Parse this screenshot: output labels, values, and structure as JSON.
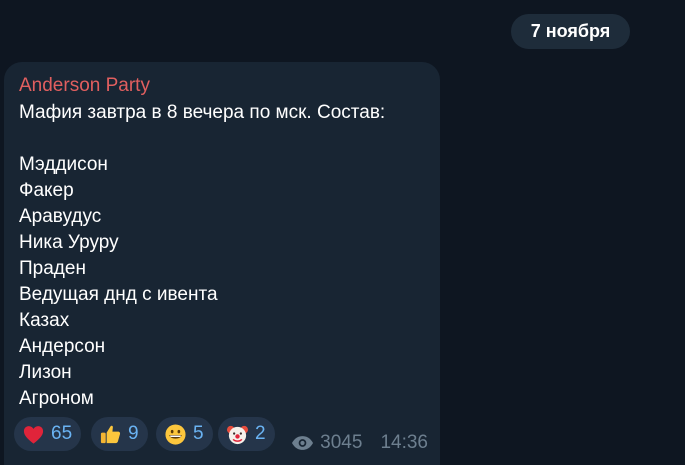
{
  "date_label": "7 ноября",
  "message": {
    "sender": "Anderson Party",
    "lines": [
      "Мафия завтра в 8 вечера по мск. Состав:",
      "",
      "Мэддисон",
      "Факер",
      "Аравудус",
      "Ника Уруру",
      "Праден",
      "Ведущая днд с ивента",
      "Казах",
      "Андерсон",
      "Лизон",
      "Агроном"
    ],
    "reactions": [
      {
        "icon": "heart-icon",
        "count": "65"
      },
      {
        "icon": "thumbs-up-icon",
        "count": "9"
      },
      {
        "icon": "grinning-face-icon",
        "count": "5"
      },
      {
        "icon": "clown-face-icon",
        "count": "2"
      }
    ],
    "views": "3045",
    "time": "14:36"
  },
  "colors": {
    "background": "#0e1621",
    "bubble": "#182533",
    "sender": "#e15f5f",
    "reaction_count": "#6ab3f3",
    "meta": "#6d7f8f"
  }
}
